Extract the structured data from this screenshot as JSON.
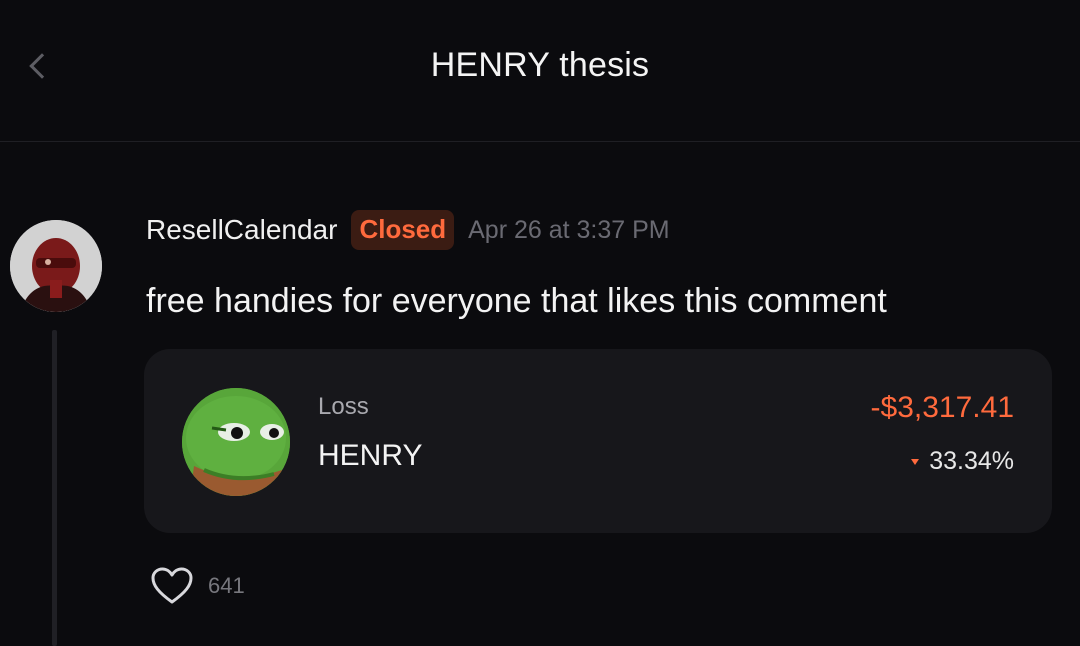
{
  "header": {
    "title": "HENRY thesis"
  },
  "comment": {
    "username": "ResellCalendar",
    "status_badge": "Closed",
    "timestamp": "Apr 26 at 3:37 PM",
    "text": "free handies for everyone that likes this comment"
  },
  "trade_card": {
    "label": "Loss",
    "ticker": "HENRY",
    "pnl": "-$3,317.41",
    "percent": "33.34%",
    "pnl_color": "#ff6a3d"
  },
  "likes": {
    "count": "641",
    "icon": "heart-icon"
  },
  "icons": {
    "back": "chevron-left-icon",
    "trend": "down-triangle-icon"
  },
  "colors": {
    "background": "#0b0b0e",
    "card": "#17171b",
    "accent": "#ff6a3d",
    "badge_bg": "#3b1c13"
  }
}
